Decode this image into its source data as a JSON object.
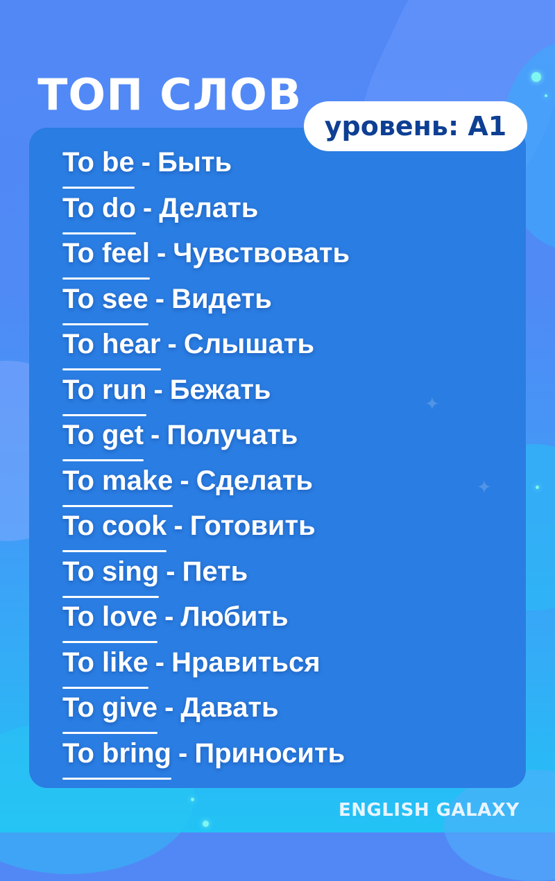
{
  "header": {
    "title": "ТОП СЛОВ",
    "level_badge": "уровень: A1"
  },
  "words": [
    {
      "en": "To be",
      "ru": "Быть"
    },
    {
      "en": "To do",
      "ru": "Делать"
    },
    {
      "en": "To feel",
      "ru": "Чувствовать"
    },
    {
      "en": "To see",
      "ru": "Видеть"
    },
    {
      "en": "To hear",
      "ru": "Слышать"
    },
    {
      "en": "To run",
      "ru": "Бежать"
    },
    {
      "en": "To get",
      "ru": "Получать"
    },
    {
      "en": "To make",
      "ru": "Сделать"
    },
    {
      "en": "To cook",
      "ru": "Готовить"
    },
    {
      "en": "To sing",
      "ru": "Петь"
    },
    {
      "en": "To love",
      "ru": "Любить"
    },
    {
      "en": "To like",
      "ru": "Нравиться"
    },
    {
      "en": "To give",
      "ru": "Давать"
    },
    {
      "en": "To bring",
      "ru": "Приносить"
    }
  ],
  "separator": "-",
  "footer": {
    "brand": "ENGLISH GALAXY"
  },
  "colors": {
    "background_top": "#5288f6",
    "background_bottom": "#22c3f5",
    "card": "#2a7de2",
    "badge_text": "#0e3f93",
    "text": "#ffffff"
  }
}
